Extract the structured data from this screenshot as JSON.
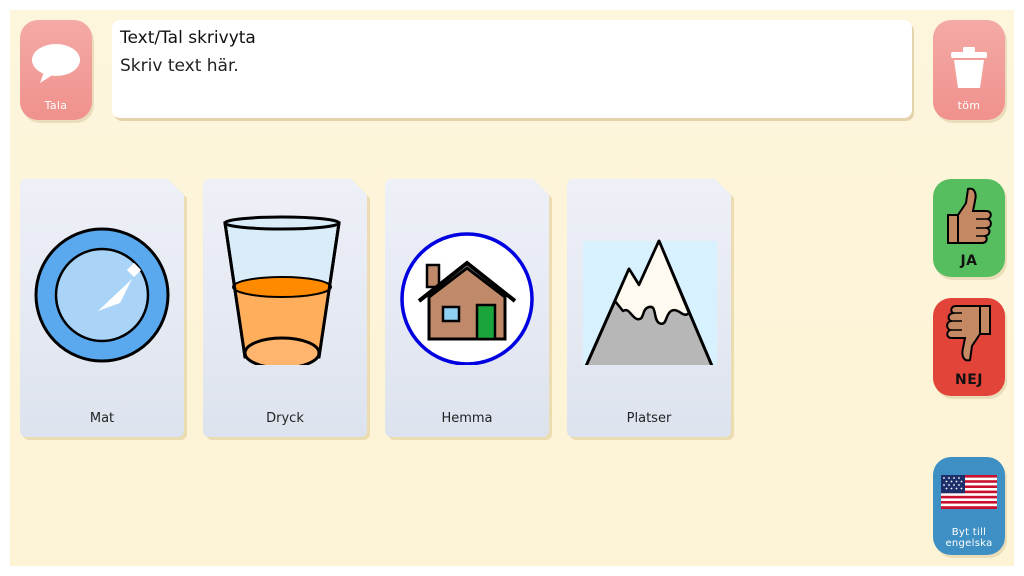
{
  "toolbar": {
    "speak_label": "Tala",
    "clear_label": "töm"
  },
  "textbox": {
    "title": "Text/Tal skrivyta",
    "placeholder": "Skriv text här."
  },
  "cards": [
    {
      "label": "Mat",
      "icon": "plate-icon"
    },
    {
      "label": "Dryck",
      "icon": "glass-icon"
    },
    {
      "label": "Hemma",
      "icon": "house-icon"
    },
    {
      "label": "Platser",
      "icon": "mountain-icon"
    }
  ],
  "side": {
    "yes_label": "JA",
    "no_label": "NEJ",
    "switch_language_label_line1": "Byt till",
    "switch_language_label_line2": "engelska"
  },
  "colors": {
    "background": "#fdf5dc",
    "speak_button": "#f0918c",
    "yes_button": "#57be5f",
    "no_button": "#e3443a",
    "language_button": "#3d8fc4"
  }
}
